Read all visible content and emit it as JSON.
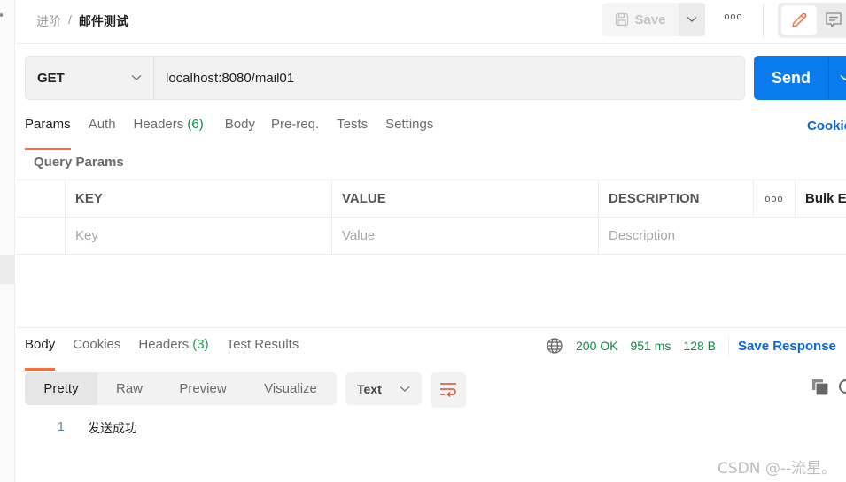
{
  "breadcrumb": {
    "parent": "进阶",
    "separator": "/",
    "current": "邮件测试"
  },
  "toolbar": {
    "save_label": "Save",
    "more_label": "ooo",
    "mode_icons": [
      "pencil-icon",
      "comment-icon"
    ]
  },
  "request": {
    "method": "GET",
    "url": "localhost:8080/mail01",
    "send_label": "Send"
  },
  "request_tabs": [
    {
      "label": "Params",
      "count": "",
      "active": true
    },
    {
      "label": "Auth",
      "count": "",
      "active": false
    },
    {
      "label": "Headers",
      "count": "(6)",
      "active": false
    },
    {
      "label": "Body",
      "count": "",
      "active": false
    },
    {
      "label": "Pre-req.",
      "count": "",
      "active": false
    },
    {
      "label": "Tests",
      "count": "",
      "active": false
    },
    {
      "label": "Settings",
      "count": "",
      "active": false
    }
  ],
  "cookies_link": "Cookies",
  "query_params": {
    "title": "Query Params",
    "columns": {
      "key": "KEY",
      "value": "VALUE",
      "description": "DESCRIPTION",
      "more": "ooo",
      "bulk_edit": "Bulk Edit"
    },
    "placeholders": {
      "key": "Key",
      "value": "Value",
      "description": "Description"
    }
  },
  "response_tabs": [
    {
      "label": "Body",
      "count": "",
      "active": true
    },
    {
      "label": "Cookies",
      "count": "",
      "active": false
    },
    {
      "label": "Headers",
      "count": "(3)",
      "active": false
    },
    {
      "label": "Test Results",
      "count": "",
      "active": false
    }
  ],
  "response_meta": {
    "status": "200 OK",
    "time": "951 ms",
    "size": "128 B",
    "save_response": "Save Response",
    "status_color": "#0a8a44"
  },
  "view_modes": [
    {
      "label": "Pretty",
      "active": true
    },
    {
      "label": "Raw",
      "active": false
    },
    {
      "label": "Preview",
      "active": false
    },
    {
      "label": "Visualize",
      "active": false
    }
  ],
  "format": "Text",
  "body_lines": [
    {
      "no": "1",
      "text": "发送成功"
    }
  ],
  "watermark": "CSDN @--流星。",
  "colors": {
    "accent": "#ff6c37",
    "send": "#097bed",
    "link": "#0b66d6"
  }
}
